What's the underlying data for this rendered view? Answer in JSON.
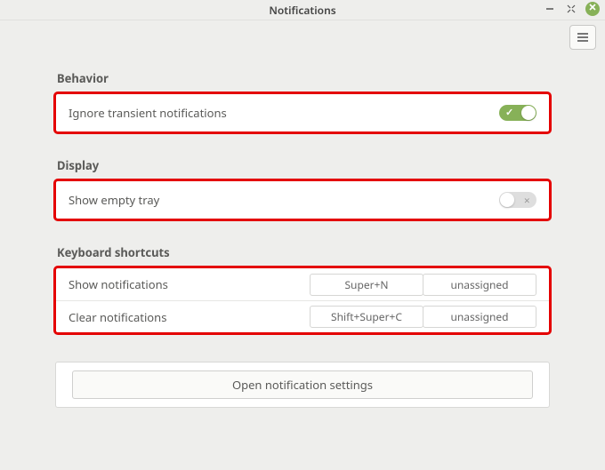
{
  "window": {
    "title": "Notifications"
  },
  "sections": {
    "behavior": {
      "label": "Behavior",
      "ignore_transient": {
        "label": "Ignore transient notifications",
        "state": "on"
      }
    },
    "display": {
      "label": "Display",
      "show_empty_tray": {
        "label": "Show empty tray",
        "state": "off"
      }
    },
    "shortcuts": {
      "label": "Keyboard shortcuts",
      "rows": [
        {
          "label": "Show notifications",
          "binding1": "Super+N",
          "binding2": "unassigned"
        },
        {
          "label": "Clear notifications",
          "binding1": "Shift+Super+C",
          "binding2": "unassigned"
        }
      ]
    }
  },
  "open_settings_label": "Open notification settings",
  "colors": {
    "accent": "#87b158",
    "highlight": "#e40000"
  }
}
